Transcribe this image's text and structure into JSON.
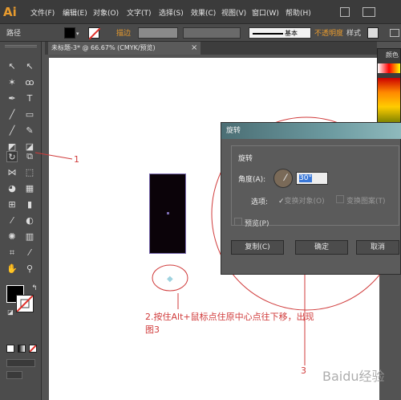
{
  "menubar": {
    "logo": "Ai",
    "items": [
      "文件(F)",
      "编辑(E)",
      "对象(O)",
      "文字(T)",
      "选择(S)",
      "效果(C)",
      "视图(V)",
      "窗口(W)",
      "帮助(H)"
    ]
  },
  "options_bar": {
    "path_label": "路径",
    "stroke_label": "描边",
    "style_value": "基本",
    "opacity_label": "不透明度",
    "style_label": "样式"
  },
  "document_tab": {
    "title": "未标题-3* @ 66.67% (CMYK/预览)"
  },
  "right_panel": {
    "label": "颜色"
  },
  "dialog": {
    "title": "旋转",
    "section_title": "旋转",
    "angle_label": "角度(A):",
    "angle_value": "30°",
    "options_label": "选项:",
    "transform_objects": "变换对象(O)",
    "transform_patterns": "变换图案(T)",
    "preview": "预览(P)",
    "copy_button": "复制(C)",
    "ok_button": "确定",
    "cancel_button": "取消"
  },
  "annotations": {
    "label1": "1",
    "label2_line1": "2.按住Alt+鼠标点住原中心点往下移，出现",
    "label2_line2": "图3",
    "label3": "3"
  },
  "watermark": "Baidu经验",
  "colors": {
    "accent_red": "#e0302a",
    "dialog_gradient": "#6c9aa0",
    "rectangle_fill": "#0b0309"
  }
}
